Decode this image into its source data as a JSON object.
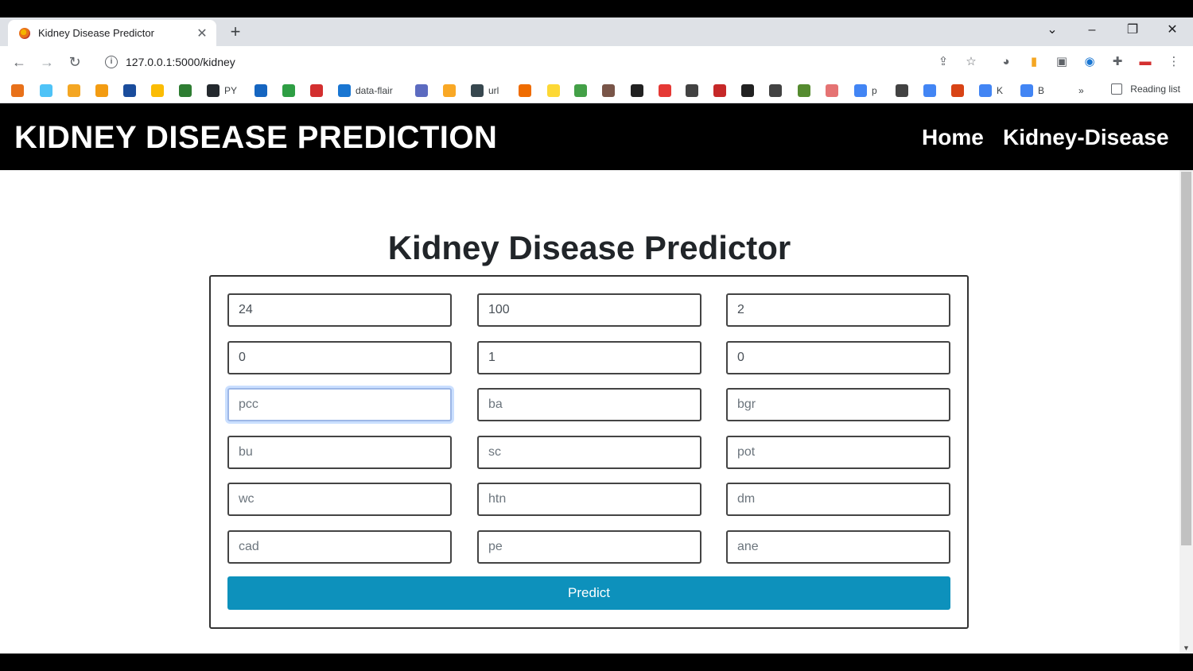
{
  "browser": {
    "tab_title": "Kidney Disease Predictor",
    "tab_close": "✕",
    "new_tab": "+",
    "url": "127.0.0.1:5000/kidney",
    "bookmarks": [
      {
        "label": "",
        "color": "#e8711a"
      },
      {
        "label": "",
        "color": "#4fc3f7"
      },
      {
        "label": "",
        "color": "#f4a623"
      },
      {
        "label": "",
        "color": "#f39c12"
      },
      {
        "label": "",
        "color": "#1a4c9c"
      },
      {
        "label": "",
        "color": "#fbbc04"
      },
      {
        "label": "",
        "color": "#2e7d32"
      },
      {
        "label": "PY",
        "color": "#24292e"
      },
      {
        "label": "",
        "color": "#1565c0"
      },
      {
        "label": "",
        "color": "#2e9e44"
      },
      {
        "label": "",
        "color": "#d32f2f"
      },
      {
        "label": "data-flair",
        "color": "#1976d2"
      },
      {
        "label": "",
        "color": "#5c6bc0"
      },
      {
        "label": "",
        "color": "#f9a825"
      },
      {
        "label": "url",
        "color": "#37474f"
      },
      {
        "label": "",
        "color": "#ef6c00"
      },
      {
        "label": "",
        "color": "#fdd835"
      },
      {
        "label": "",
        "color": "#43a047"
      },
      {
        "label": "",
        "color": "#795548"
      },
      {
        "label": "",
        "color": "#212121"
      },
      {
        "label": "",
        "color": "#e53935"
      },
      {
        "label": "",
        "color": "#424242"
      },
      {
        "label": "",
        "color": "#c62828"
      },
      {
        "label": "",
        "color": "#212121"
      },
      {
        "label": "",
        "color": "#424242"
      },
      {
        "label": "",
        "color": "#558b2f"
      },
      {
        "label": "",
        "color": "#e57373"
      },
      {
        "label": "p",
        "color": "#4285f4"
      },
      {
        "label": "",
        "color": "#424242"
      },
      {
        "label": "",
        "color": "#4285f4"
      },
      {
        "label": "",
        "color": "#d84315"
      },
      {
        "label": "K",
        "color": "#4285f4"
      },
      {
        "label": "B",
        "color": "#4285f4"
      }
    ],
    "overflow": "»",
    "reading_list": "Reading list"
  },
  "navbar": {
    "brand": "KIDNEY DISEASE PREDICTION",
    "links": [
      "Home",
      "Kidney-Disease"
    ]
  },
  "main": {
    "heading": "Kidney Disease Predictor",
    "fields": [
      {
        "value": "24",
        "placeholder": ""
      },
      {
        "value": "100",
        "placeholder": ""
      },
      {
        "value": "2",
        "placeholder": ""
      },
      {
        "value": "0",
        "placeholder": ""
      },
      {
        "value": "1",
        "placeholder": ""
      },
      {
        "value": "0",
        "placeholder": ""
      },
      {
        "value": "",
        "placeholder": "pcc"
      },
      {
        "value": "",
        "placeholder": "ba"
      },
      {
        "value": "",
        "placeholder": "bgr"
      },
      {
        "value": "",
        "placeholder": "bu"
      },
      {
        "value": "",
        "placeholder": "sc"
      },
      {
        "value": "",
        "placeholder": "pot"
      },
      {
        "value": "",
        "placeholder": "wc"
      },
      {
        "value": "",
        "placeholder": "htn"
      },
      {
        "value": "",
        "placeholder": "dm"
      },
      {
        "value": "",
        "placeholder": "cad"
      },
      {
        "value": "",
        "placeholder": "pe"
      },
      {
        "value": "",
        "placeholder": "ane"
      }
    ],
    "submit_label": "Predict",
    "accent_color": "#0d91bc"
  }
}
